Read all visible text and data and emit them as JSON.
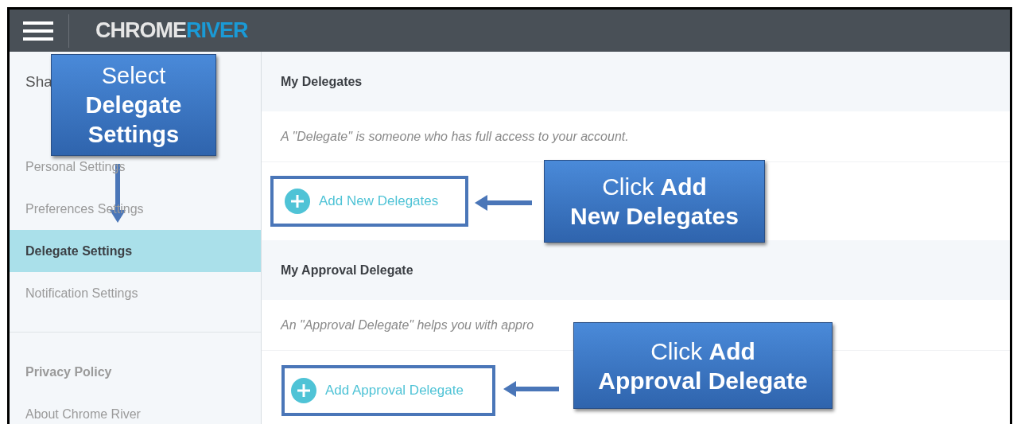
{
  "header": {
    "logo": {
      "part_1": "CHROME",
      "part_2": "RIVER"
    }
  },
  "sidebar": {
    "items": [
      {
        "label": "Sha",
        "selected": false
      },
      {
        "label": "Personal Settings",
        "selected": false
      },
      {
        "label": "Preferences Settings",
        "selected": false
      },
      {
        "label": "Delegate Settings",
        "selected": true
      },
      {
        "label": "Notification Settings",
        "selected": false
      }
    ],
    "footer_links": [
      "Privacy Policy",
      "About Chrome River"
    ]
  },
  "sections": [
    {
      "title": "My Delegates",
      "description": "A \"Delegate\" is someone who has full access to your account.",
      "button": "Add New Delegates"
    },
    {
      "title": "My Approval Delegate",
      "description": "An \"Approval Delegate\" helps you with appro",
      "button": "Add Approval Delegate"
    }
  ],
  "callouts": [
    {
      "lines": [
        "Select",
        "**Delegate**",
        "**Settings**"
      ]
    },
    {
      "lines": [
        "Click **Add**",
        "**New Delegates**"
      ]
    },
    {
      "lines": [
        "Click **Add**",
        "**Approval Delegate**"
      ]
    }
  ]
}
